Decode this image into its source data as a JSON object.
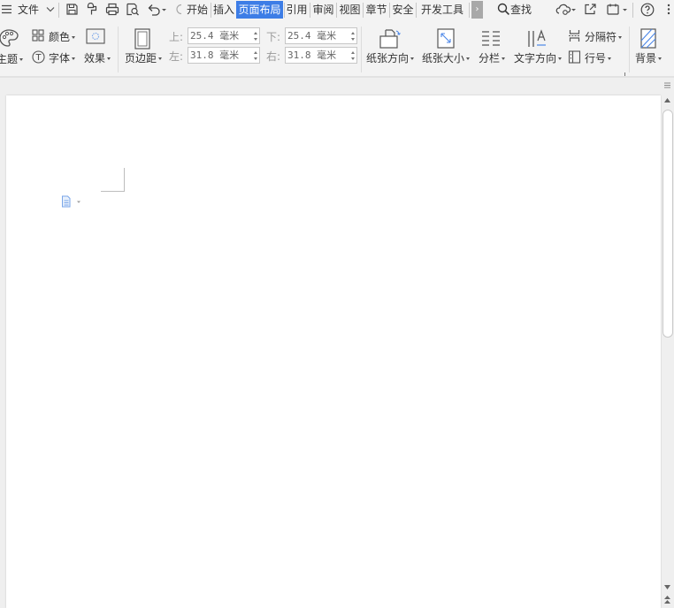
{
  "menu": {
    "file_label": "文件",
    "search_label": "查找"
  },
  "tabs": [
    {
      "label": "开始"
    },
    {
      "label": "插入"
    },
    {
      "label": "页面布局"
    },
    {
      "label": "引用"
    },
    {
      "label": "审阅"
    },
    {
      "label": "视图"
    },
    {
      "label": "章节"
    },
    {
      "label": "安全"
    },
    {
      "label": "开发工具"
    }
  ],
  "active_tab": "页面布局",
  "more_tabs_glyph": "›",
  "ribbon": {
    "theme_label": "主题",
    "color_label": "颜色",
    "font_label": "字体",
    "effect_label": "效果",
    "margins_label": "页边距",
    "margin_top_label": "上:",
    "margin_top_value": "25.4 毫米",
    "margin_bottom_label": "下:",
    "margin_bottom_value": "25.4 毫米",
    "margin_left_label": "左:",
    "margin_left_value": "31.8 毫米",
    "margin_right_label": "右:",
    "margin_right_value": "31.8 毫米",
    "orientation_label": "纸张方向",
    "size_label": "纸张大小",
    "columns_label": "分栏",
    "text_direction_label": "文字方向",
    "separator_label": "分隔符",
    "line_number_label": "行号",
    "background_label": "背景"
  },
  "colors": {
    "accent": "#3d7de6",
    "ribbon_bg": "#f3f3f3",
    "page_bg": "#ffffff"
  }
}
